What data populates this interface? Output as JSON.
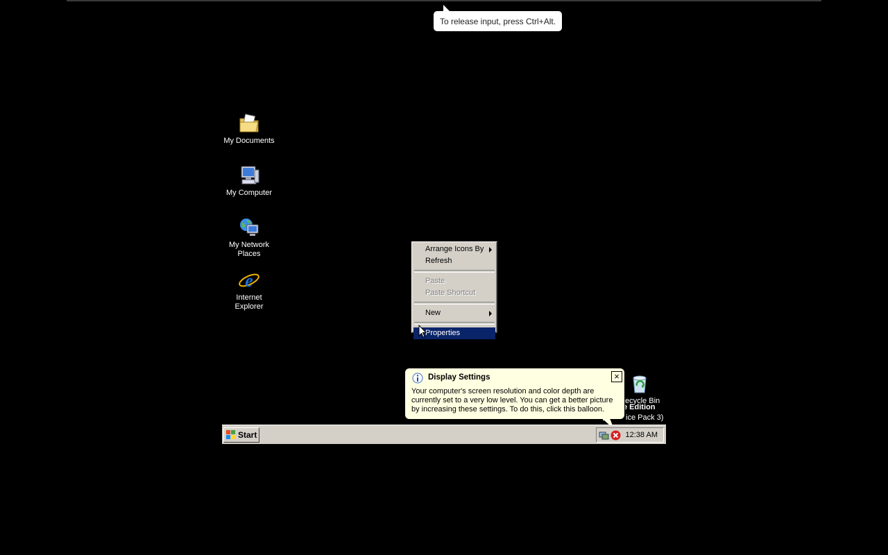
{
  "host": {
    "tooltip": "To release input, press Ctrl+Alt."
  },
  "desktop": {
    "icons": [
      {
        "label": "My Documents",
        "icon": "my-documents-icon"
      },
      {
        "label": "My Computer",
        "icon": "my-computer-icon"
      },
      {
        "label": "My Network Places",
        "icon": "network-places-icon"
      },
      {
        "label": "Internet Explorer",
        "icon": "internet-explorer-icon"
      },
      {
        "label": "ecycle Bin",
        "icon": "recycle-bin-icon"
      }
    ],
    "watermark": {
      "line1": "e Edition",
      "line2": "ice Pack 3)"
    }
  },
  "context_menu": {
    "items": [
      {
        "label": "Arrange Icons By",
        "submenu": true,
        "enabled": true
      },
      {
        "label": "Refresh",
        "submenu": false,
        "enabled": true
      },
      {
        "label": "Paste",
        "submenu": false,
        "enabled": false
      },
      {
        "label": "Paste Shortcut",
        "submenu": false,
        "enabled": false
      },
      {
        "label": "New",
        "submenu": true,
        "enabled": true
      },
      {
        "label": "Properties",
        "submenu": false,
        "enabled": true,
        "highlighted": true
      }
    ]
  },
  "balloon": {
    "title": "Display Settings",
    "text": "Your computer's screen resolution and color depth are currently set to a very low level. You can get a better picture by increasing these settings. To do this, click this balloon.",
    "close": "×"
  },
  "taskbar": {
    "start_label": "Start",
    "clock": "12:38 AM"
  },
  "colors": {
    "menu_highlight": "#0a246a",
    "balloon_bg": "#ffffe1",
    "taskbar_bg": "#d4d0c8"
  }
}
